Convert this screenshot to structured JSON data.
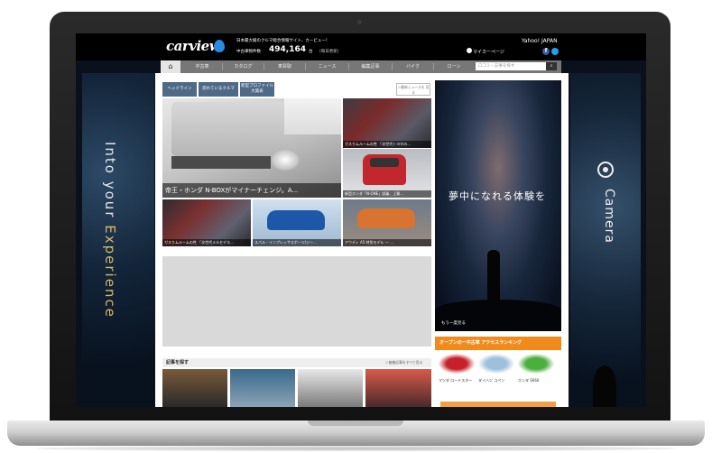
{
  "site": {
    "logo": "carview",
    "tagline": "日本最大級のクルマ総合情報サイト、カービュー！",
    "count_label": "中古車物件数",
    "count": "494,164",
    "count_unit": "台",
    "count_note": "(毎日更新)",
    "yahoo": "Yahoo! JAPAN",
    "mypage": "マイカーページ"
  },
  "nav": {
    "home_icon": "home-icon",
    "items": [
      "中古車",
      "カタログ",
      "車買取",
      "ニュース",
      "編集記事",
      "バイク",
      "ローン"
    ],
    "search_placeholder": "ロコミ・記事を探す",
    "search_icon": "search-icon"
  },
  "tabs": [
    "ヘッドライン",
    "売れているクルマ",
    "新型プロファイル 大発表"
  ],
  "news_link": "＞最新ニュースを 見る",
  "hero": {
    "caption": "帝王・ホンダ N-BOXがマイナーチェンジ。A..."
  },
  "thumbs": [
    {
      "caption": "ガスりムルームの性 「次世代トヨタの..."
    },
    {
      "caption": "新型ホンダ「N-ONE」試乗、上質..."
    },
    {
      "caption": "ガスりムルームの性 「次世代メルセデス..."
    },
    {
      "caption": "スバル・インプレッサスポーツ/ジー..."
    },
    {
      "caption": "アウディ A5 特別モデル ー ..."
    }
  ],
  "find_articles": {
    "title": "記事を探す",
    "more": "＞編集記事をすべて見る"
  },
  "left_banner": {
    "text_a": "Into your ",
    "text_b": "Experience"
  },
  "right_banner": {
    "text": "Camera",
    "icon": "camera-icon"
  },
  "mid_ad": {
    "headline": "夢中になれる体験を",
    "link": "もう一度見る"
  },
  "ranking": {
    "title": "オープンの一中古車 アクセスランキング",
    "items": [
      "マツダ ロードスター",
      "ダイハツ コペン",
      "ホンダ S660"
    ]
  }
}
